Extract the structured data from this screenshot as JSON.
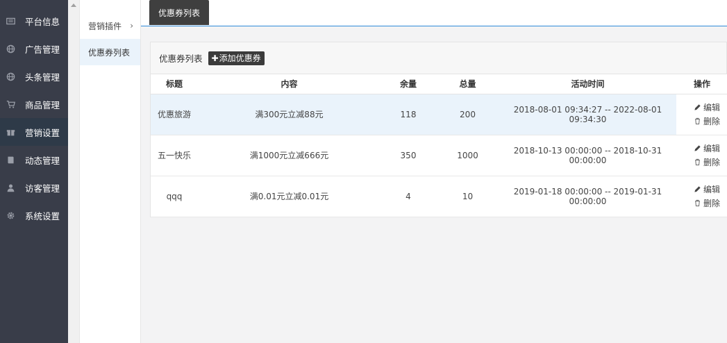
{
  "sidebar": {
    "items": [
      {
        "label": "平台信息",
        "icon": "newspaper-icon"
      },
      {
        "label": "广告管理",
        "icon": "globe-icon"
      },
      {
        "label": "头条管理",
        "icon": "globe-icon"
      },
      {
        "label": "商品管理",
        "icon": "cart-icon"
      },
      {
        "label": "营销设置",
        "icon": "gift-icon"
      },
      {
        "label": "动态管理",
        "icon": "book-icon"
      },
      {
        "label": "访客管理",
        "icon": "user-icon"
      },
      {
        "label": "系统设置",
        "icon": "gear-icon"
      }
    ],
    "active_index": 4
  },
  "submenu": {
    "parent_label": "营销插件",
    "active_label": "优惠券列表"
  },
  "topbar": {
    "tab_label": "优惠券列表"
  },
  "panel": {
    "title": "优惠券列表",
    "add_button": "添加优惠券",
    "columns": [
      "标题",
      "内容",
      "余量",
      "总量",
      "活动时间",
      "操作"
    ],
    "rows": [
      {
        "title": "优惠旅游",
        "content": "满300元立减88元",
        "remaining": "118",
        "total": "200",
        "time": "2018-08-01 09:34:27 -- 2022-08-01 09:34:30"
      },
      {
        "title": "五一快乐",
        "content": "满1000元立减666元",
        "remaining": "350",
        "total": "1000",
        "time": "2018-10-13 00:00:00 -- 2018-10-31 00:00:00"
      },
      {
        "title": "qqq",
        "content": "满0.01元立减0.01元",
        "remaining": "4",
        "total": "10",
        "time": "2019-01-18 00:00:00 -- 2019-01-31 00:00:00"
      }
    ],
    "edit_label": "编辑",
    "delete_label": "删除"
  }
}
